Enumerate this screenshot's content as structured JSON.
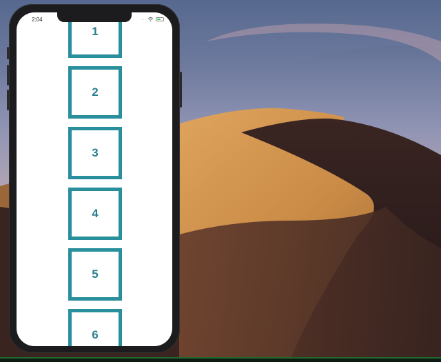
{
  "status_bar": {
    "time": "2:04",
    "signal": "....",
    "wifi_icon": "wifi-icon",
    "battery_icon": "battery-icon",
    "battery_level": 0.6,
    "battery_color": "#34c759"
  },
  "list": {
    "items": [
      {
        "label": "1"
      },
      {
        "label": "2"
      },
      {
        "label": "3"
      },
      {
        "label": "4"
      },
      {
        "label": "5"
      },
      {
        "label": "6"
      }
    ],
    "border_color": "#2a8f9c",
    "text_color": "#2a7f8c"
  },
  "colors": {
    "phone_frame": "#1c1c1e",
    "screen_background": "#ffffff"
  }
}
